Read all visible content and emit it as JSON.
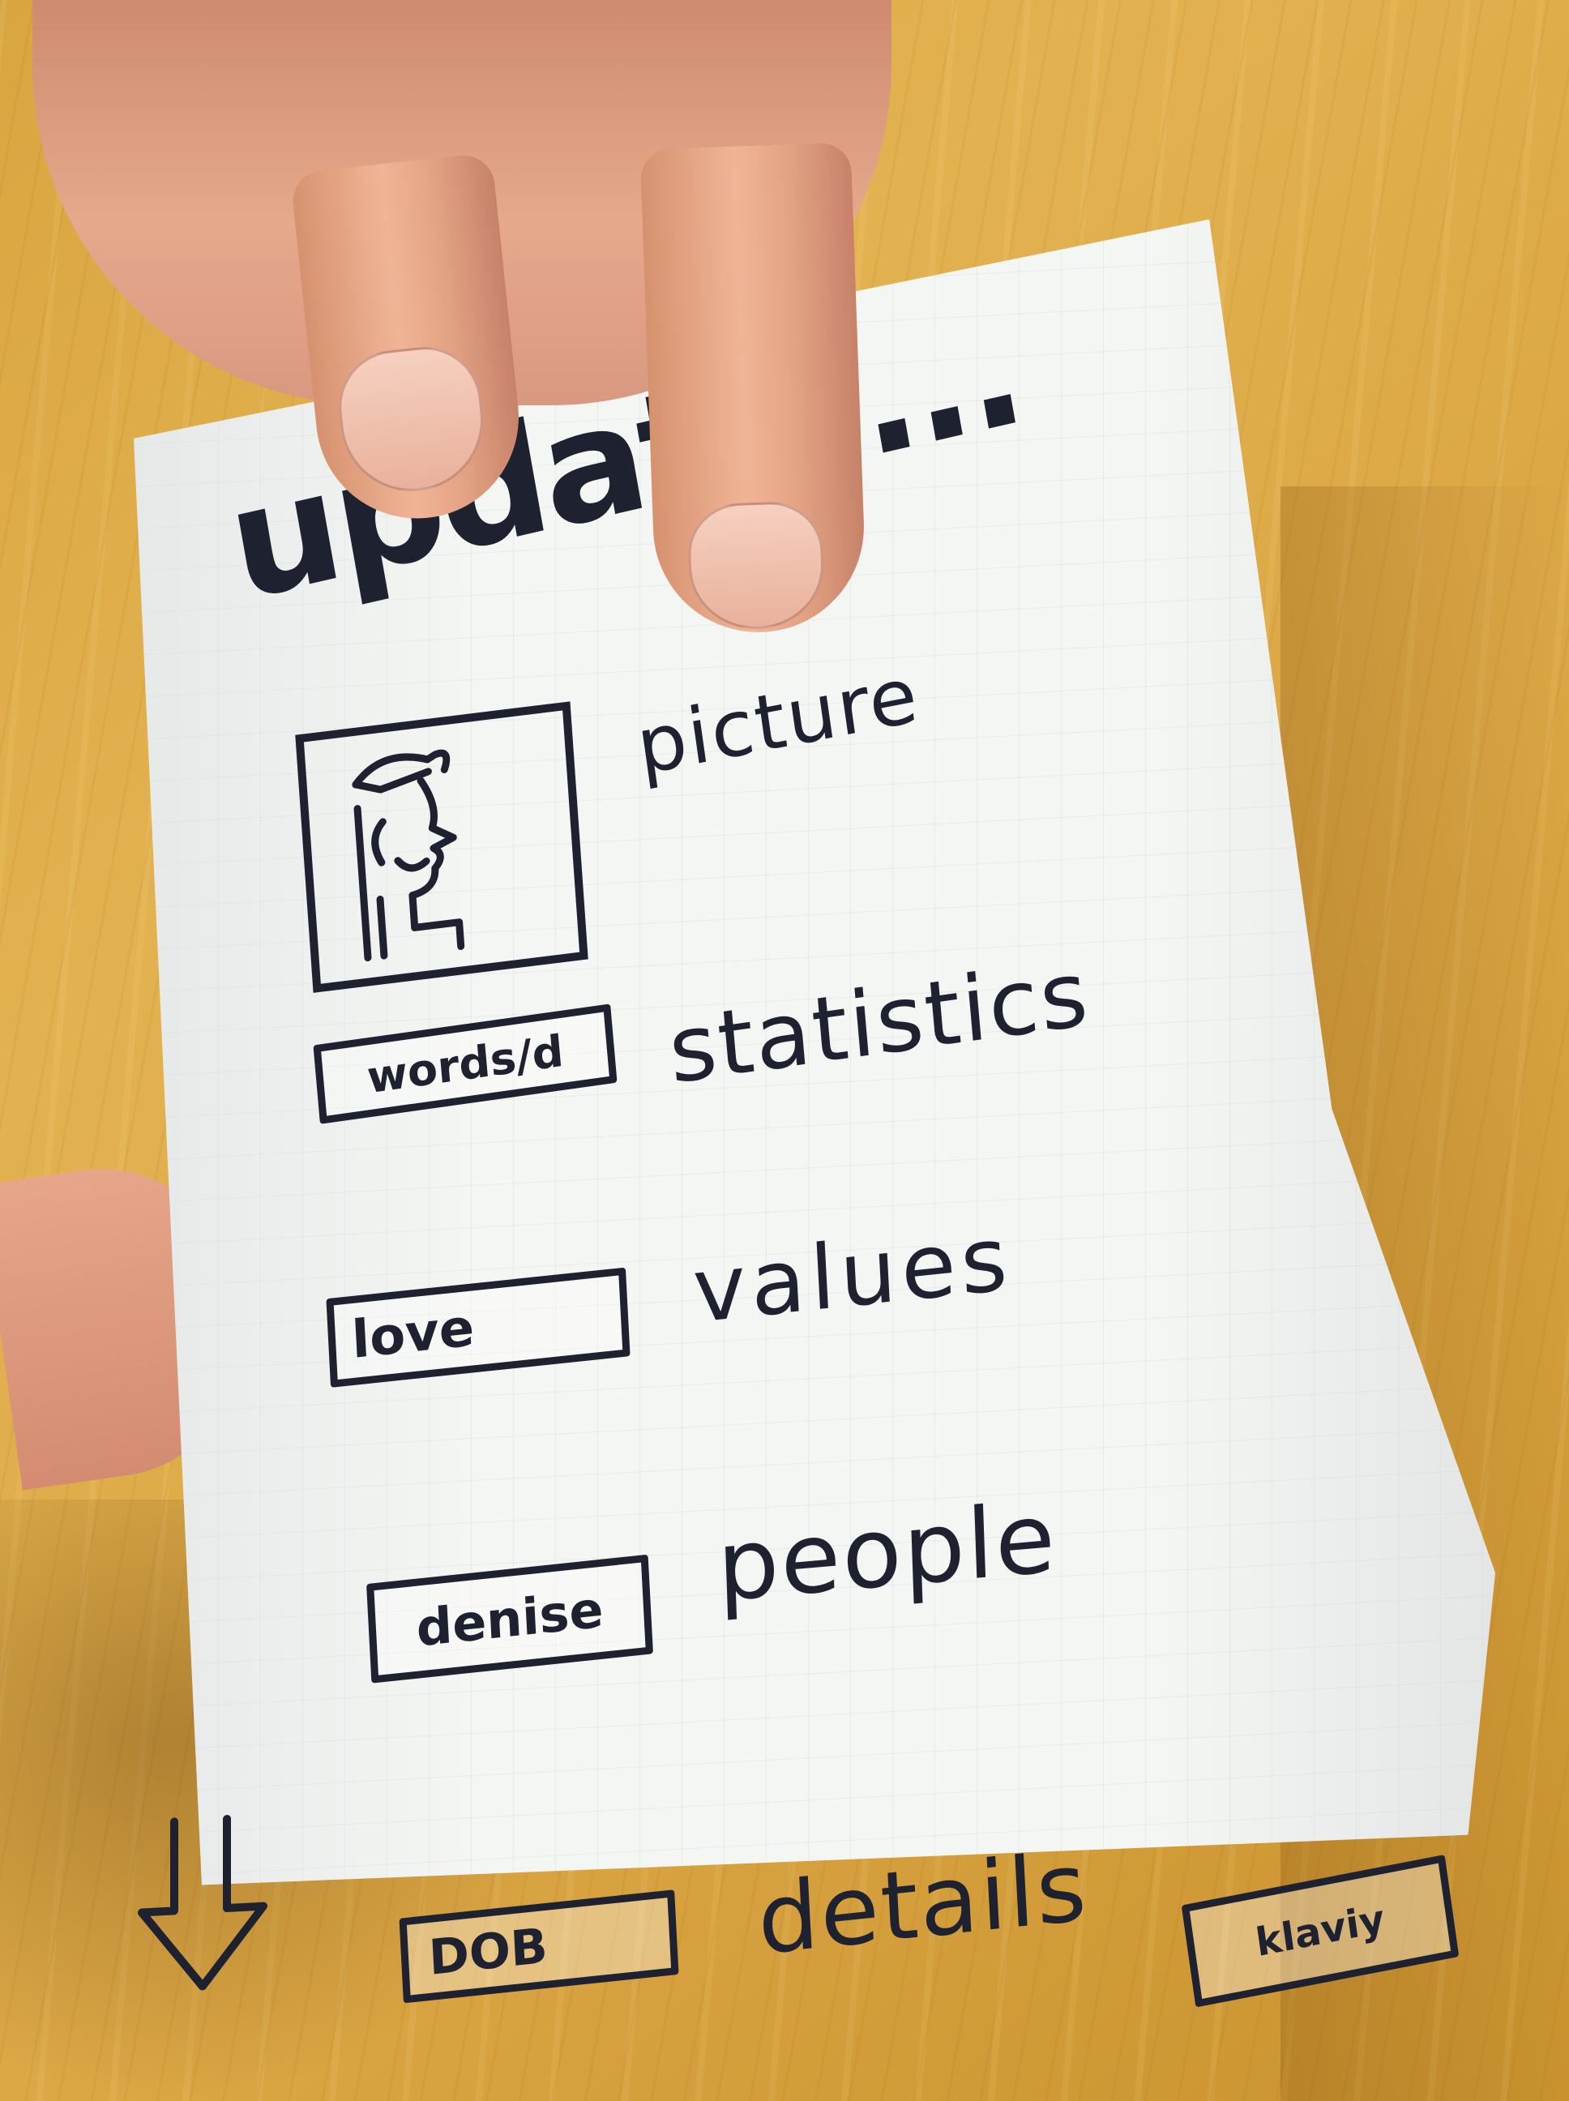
{
  "sketch": {
    "title": "update....",
    "rows": [
      {
        "label": "picture"
      },
      {
        "label": "statistics",
        "box_text": "words/d"
      },
      {
        "label": "values",
        "box_text": "love"
      },
      {
        "label": "people",
        "box_text": "denise"
      },
      {
        "label": "details",
        "box_text": "DOB",
        "extra_box_text": "klaviy"
      }
    ],
    "scroll_icon": "down-arrow-icon",
    "avatar_icon": "person-with-cap-icon"
  },
  "colors": {
    "ink": "#1e2230",
    "paper": "#f4f6f3",
    "table": "#d9a541",
    "skin": "#e8a98a"
  }
}
